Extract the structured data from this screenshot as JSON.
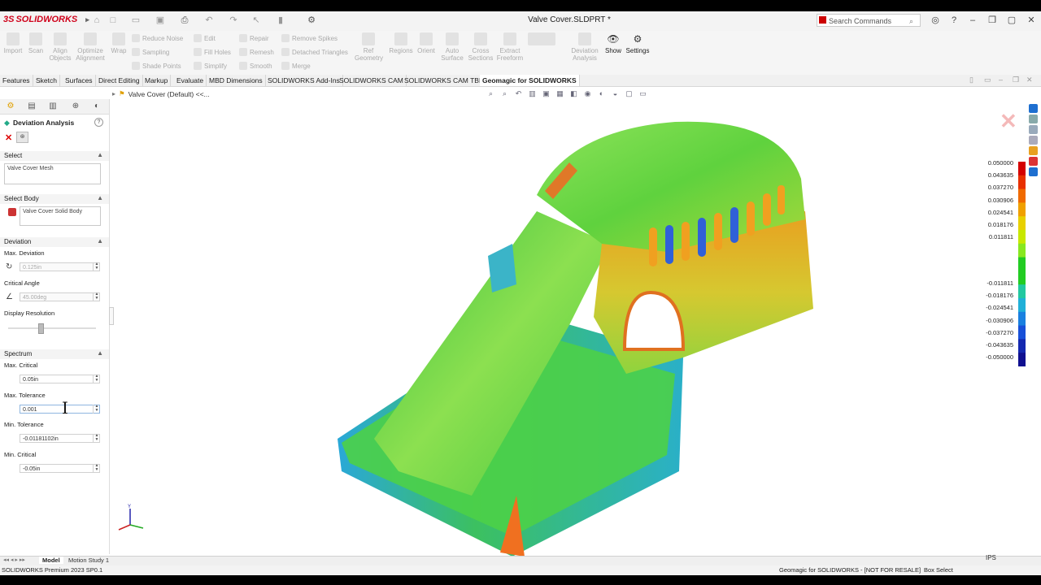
{
  "app": {
    "logo_text": "SOLIDWORKS",
    "document_title": "Valve Cover.SLDPRT *",
    "search_placeholder": "Search Commands"
  },
  "ribbon": {
    "buttons": {
      "import": "Import",
      "scan": "Scan",
      "align_objects": "Align\nObjects",
      "optimize_alignment": "Optimize\nAlignment",
      "wrap": "Wrap",
      "ref_geometry": "Ref\nGeometry",
      "regions": "Regions",
      "orient": "Orient",
      "auto_surface": "Auto\nSurface",
      "cross_sections": "Cross\nSections",
      "extract_freeform": "Extract\nFreeform",
      "deviation_analysis": "Deviation\nAnalysis",
      "show": "Show",
      "settings": "Settings"
    },
    "small": {
      "reduce_noise": "Reduce Noise",
      "sampling": "Sampling",
      "shade_points": "Shade Points",
      "edit": "Edit",
      "fill_holes": "Fill Holes",
      "simplify": "Simplify",
      "repair": "Repair",
      "remesh": "Remesh",
      "smooth": "Smooth",
      "remove_spikes": "Remove Spikes",
      "detached_triangles": "Detached Triangles",
      "merge": "Merge"
    }
  },
  "tabs": [
    "Features",
    "Sketch",
    "Surfaces",
    "Direct Editing",
    "Markup",
    "Evaluate",
    "MBD Dimensions",
    "SOLIDWORKS Add-Ins",
    "SOLIDWORKS CAM",
    "SOLIDWORKS CAM TBM",
    "Geomagic for SOLIDWORKS"
  ],
  "breadcrumb": "Valve Cover (Default) <<...",
  "property_manager": {
    "title": "Deviation Analysis",
    "select": {
      "header": "Select",
      "item": "Valve Cover Mesh"
    },
    "select_body": {
      "header": "Select Body",
      "item": "Valve Cover Solid Body"
    },
    "deviation": {
      "header": "Deviation",
      "max_deviation_label": "Max. Deviation",
      "max_deviation_value": "0.125in",
      "critical_angle_label": "Critical Angle",
      "critical_angle_value": "45.00deg",
      "display_resolution_label": "Display Resolution",
      "display_resolution_level": 0.37
    },
    "spectrum": {
      "header": "Spectrum",
      "max_critical_label": "Max. Critical",
      "max_critical_value": "0.05in",
      "max_tolerance_label": "Max. Tolerance",
      "max_tolerance_value": "0.001",
      "min_tolerance_label": "Min. Tolerance",
      "min_tolerance_value": "-0.01181102in",
      "min_critical_label": "Min. Critical",
      "min_critical_value": "-0.05in"
    }
  },
  "legend": {
    "positive": [
      "0.050000",
      "0.043635",
      "0.037270",
      "0.030906",
      "0.024541",
      "0.018176",
      "0.011811"
    ],
    "negative": [
      "-0.011811",
      "-0.018176",
      "-0.024541",
      "-0.030906",
      "-0.037270",
      "-0.043635",
      "-0.050000"
    ]
  },
  "bottom_tabs": {
    "model": "Model",
    "motion_study": "Motion Study 1"
  },
  "status": {
    "left": "SOLIDWORKS Premium 2023 SP0.1",
    "geomagic": "Geomagic for SOLIDWORKS - [NOT FOR RESALE]",
    "mode": "Box Select",
    "units": "IPS"
  },
  "colors": {
    "brand_red": "#d0021b",
    "legend_top": "#d40000",
    "legend_mid": "#22cc22",
    "legend_bottom": "#101090"
  }
}
